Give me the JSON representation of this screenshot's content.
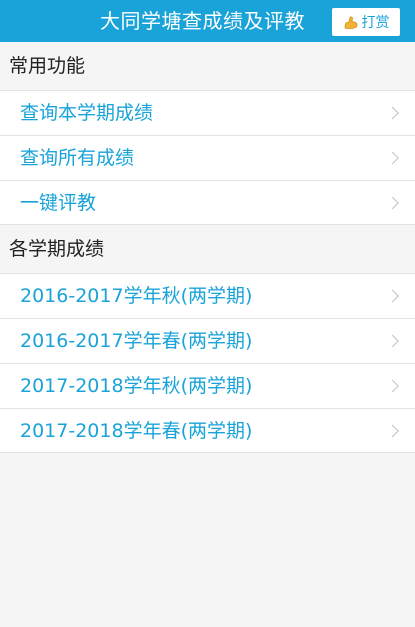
{
  "header": {
    "title": "大同学塘查成绩及评教",
    "reward_label": "打赏",
    "reward_icon": "flexed-arm-icon"
  },
  "common": {
    "title": "常用功能",
    "items": [
      {
        "label": "查询本学期成绩"
      },
      {
        "label": "查询所有成绩"
      },
      {
        "label": "一键评教"
      }
    ]
  },
  "terms": {
    "title": "各学期成绩",
    "items": [
      {
        "label": "2016-2017学年秋(两学期)"
      },
      {
        "label": "2016-2017学年春(两学期)"
      },
      {
        "label": "2017-2018学年秋(两学期)"
      },
      {
        "label": "2017-2018学年春(两学期)"
      }
    ]
  },
  "colors": {
    "accent": "#1aa3d9",
    "background": "#f5f5f5"
  }
}
